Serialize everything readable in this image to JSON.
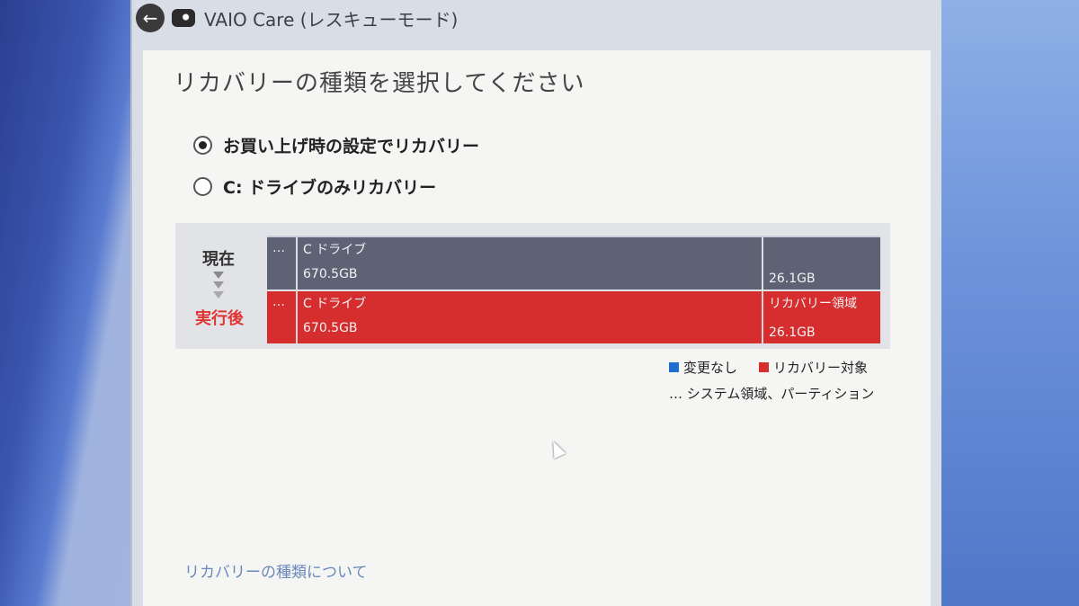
{
  "window": {
    "title": "VAIO Care (レスキューモード)",
    "back_icon": "arrow-left-icon",
    "app_icon": "vaio-care-icon"
  },
  "page": {
    "heading": "リカバリーの種類を選択してください",
    "options": [
      {
        "label": "お買い上げ時の設定でリカバリー",
        "selected": true
      },
      {
        "label": "C: ドライブのみリカバリー",
        "selected": false
      }
    ]
  },
  "diagram": {
    "current_label": "現在",
    "after_label": "実行後",
    "current_bar": {
      "system": "…",
      "c_drive_name": "C ドライブ",
      "c_drive_size": "670.5GB",
      "recovery_name": "",
      "recovery_size": "26.1GB"
    },
    "after_bar": {
      "system": "…",
      "c_drive_name": "C ドライブ",
      "c_drive_size": "670.5GB",
      "recovery_name": "リカバリー領域",
      "recovery_size": "26.1GB"
    }
  },
  "legend": {
    "unchanged": "変更なし",
    "recovery_target": "リカバリー対象",
    "system_note": "… システム領域、パーティション",
    "colors": {
      "unchanged": "#1f6fd1",
      "recovery_target": "#d62d2f"
    }
  },
  "footer": {
    "about_link": "リカバリーの種類について"
  }
}
